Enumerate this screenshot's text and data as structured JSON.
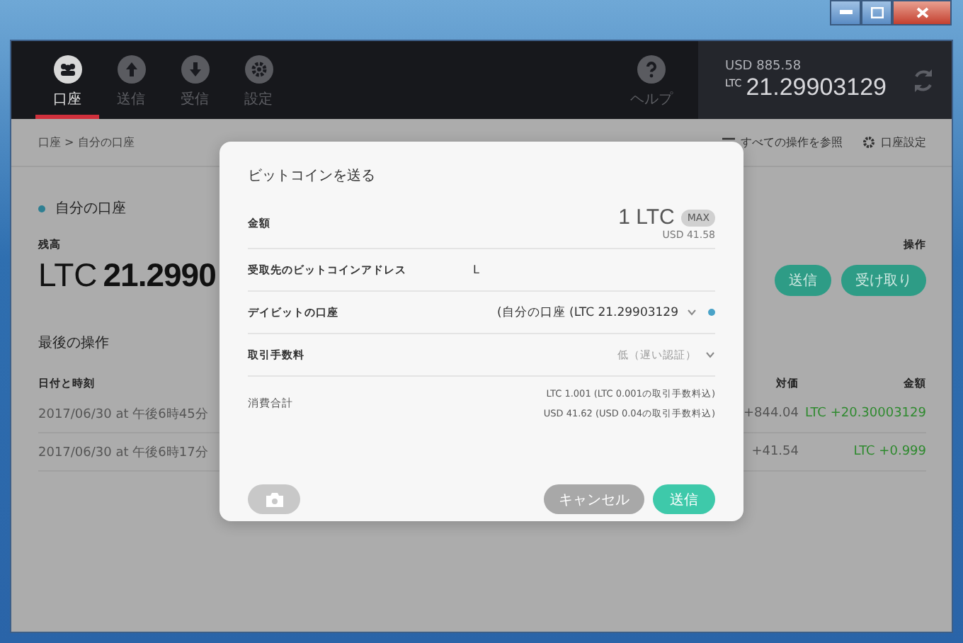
{
  "nav": {
    "tabs": [
      {
        "label": "口座",
        "selected": true
      },
      {
        "label": "送信",
        "selected": false
      },
      {
        "label": "受信",
        "selected": false
      },
      {
        "label": "設定",
        "selected": false
      }
    ],
    "help": "ヘルプ",
    "wallet": {
      "usd": "USD 885.58",
      "currency": "LTC",
      "amount": "21.29903129"
    }
  },
  "subbar": {
    "breadcrumb": "口座 > 自分の口座",
    "links": [
      "すべての操作を参照",
      "口座設定"
    ]
  },
  "account": {
    "name": "自分の口座",
    "balance_label": "残高",
    "currency": "LTC",
    "amount": "21.2990",
    "actions_label": "操作",
    "buttons": [
      "送信",
      "受け取り"
    ]
  },
  "history": {
    "title": "最後の操作",
    "columns": [
      "日付と時刻",
      "対価",
      "金額"
    ],
    "rows": [
      {
        "date": "2017/06/30 at 午後6時45分",
        "value": "+844.04",
        "amount": "LTC +20.30003129"
      },
      {
        "date": "2017/06/30 at 午後6時17分",
        "value": "+41.54",
        "amount": "LTC +0.999"
      }
    ]
  },
  "dialog": {
    "title": "ビットコインを送る",
    "rows": [
      {
        "kind": "amount",
        "label": "金額",
        "value": "1 LTC",
        "badge": "MAX",
        "sub": "USD 41.58"
      },
      {
        "kind": "text",
        "label": "受取先のビットコインアドレス",
        "value": "L"
      },
      {
        "kind": "select",
        "label": "デイビットの口座",
        "value": "(自分の口座 (LTC 21.29903129",
        "dot": true
      },
      {
        "kind": "select",
        "label": "取引手数料",
        "value": "低（遅い認証）",
        "dot": false
      },
      {
        "kind": "total",
        "label": "消費合計",
        "lines": [
          "LTC 1.001 (LTC 0.001の取引手数料込)",
          "USD 41.62 (USD 0.04の取引手数料込)"
        ]
      }
    ],
    "cancel": "キャンセル",
    "send": "送信"
  }
}
